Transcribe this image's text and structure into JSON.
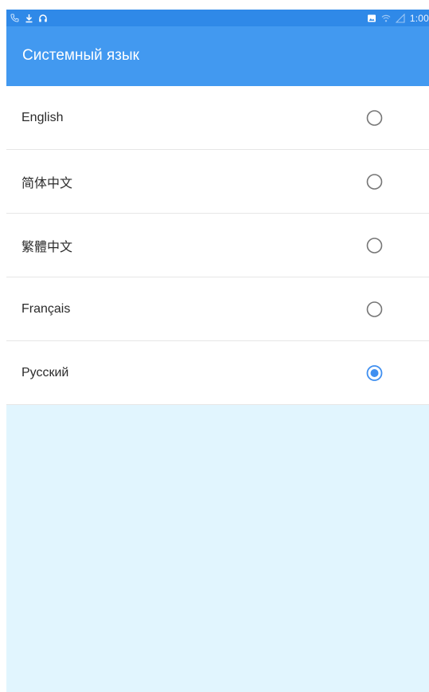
{
  "status_bar": {
    "time": "1:00",
    "left_icons": [
      "call-forwarding-icon",
      "download-icon",
      "headset-icon"
    ],
    "right_icons": [
      "gallery-icon",
      "wifi-icon",
      "signal-icon"
    ]
  },
  "app_bar": {
    "title": "Системный язык"
  },
  "languages": [
    {
      "label": "English",
      "selected": false
    },
    {
      "label": "简体中文",
      "selected": false
    },
    {
      "label": "繁體中文",
      "selected": false
    },
    {
      "label": "Français",
      "selected": false
    },
    {
      "label": "Русский",
      "selected": true
    }
  ],
  "colors": {
    "status_bar": "#2f89e8",
    "app_bar": "#4299f0",
    "radio_selected": "#3f8ff0",
    "radio_unselected": "#757575",
    "background": "#e1f5fe"
  }
}
